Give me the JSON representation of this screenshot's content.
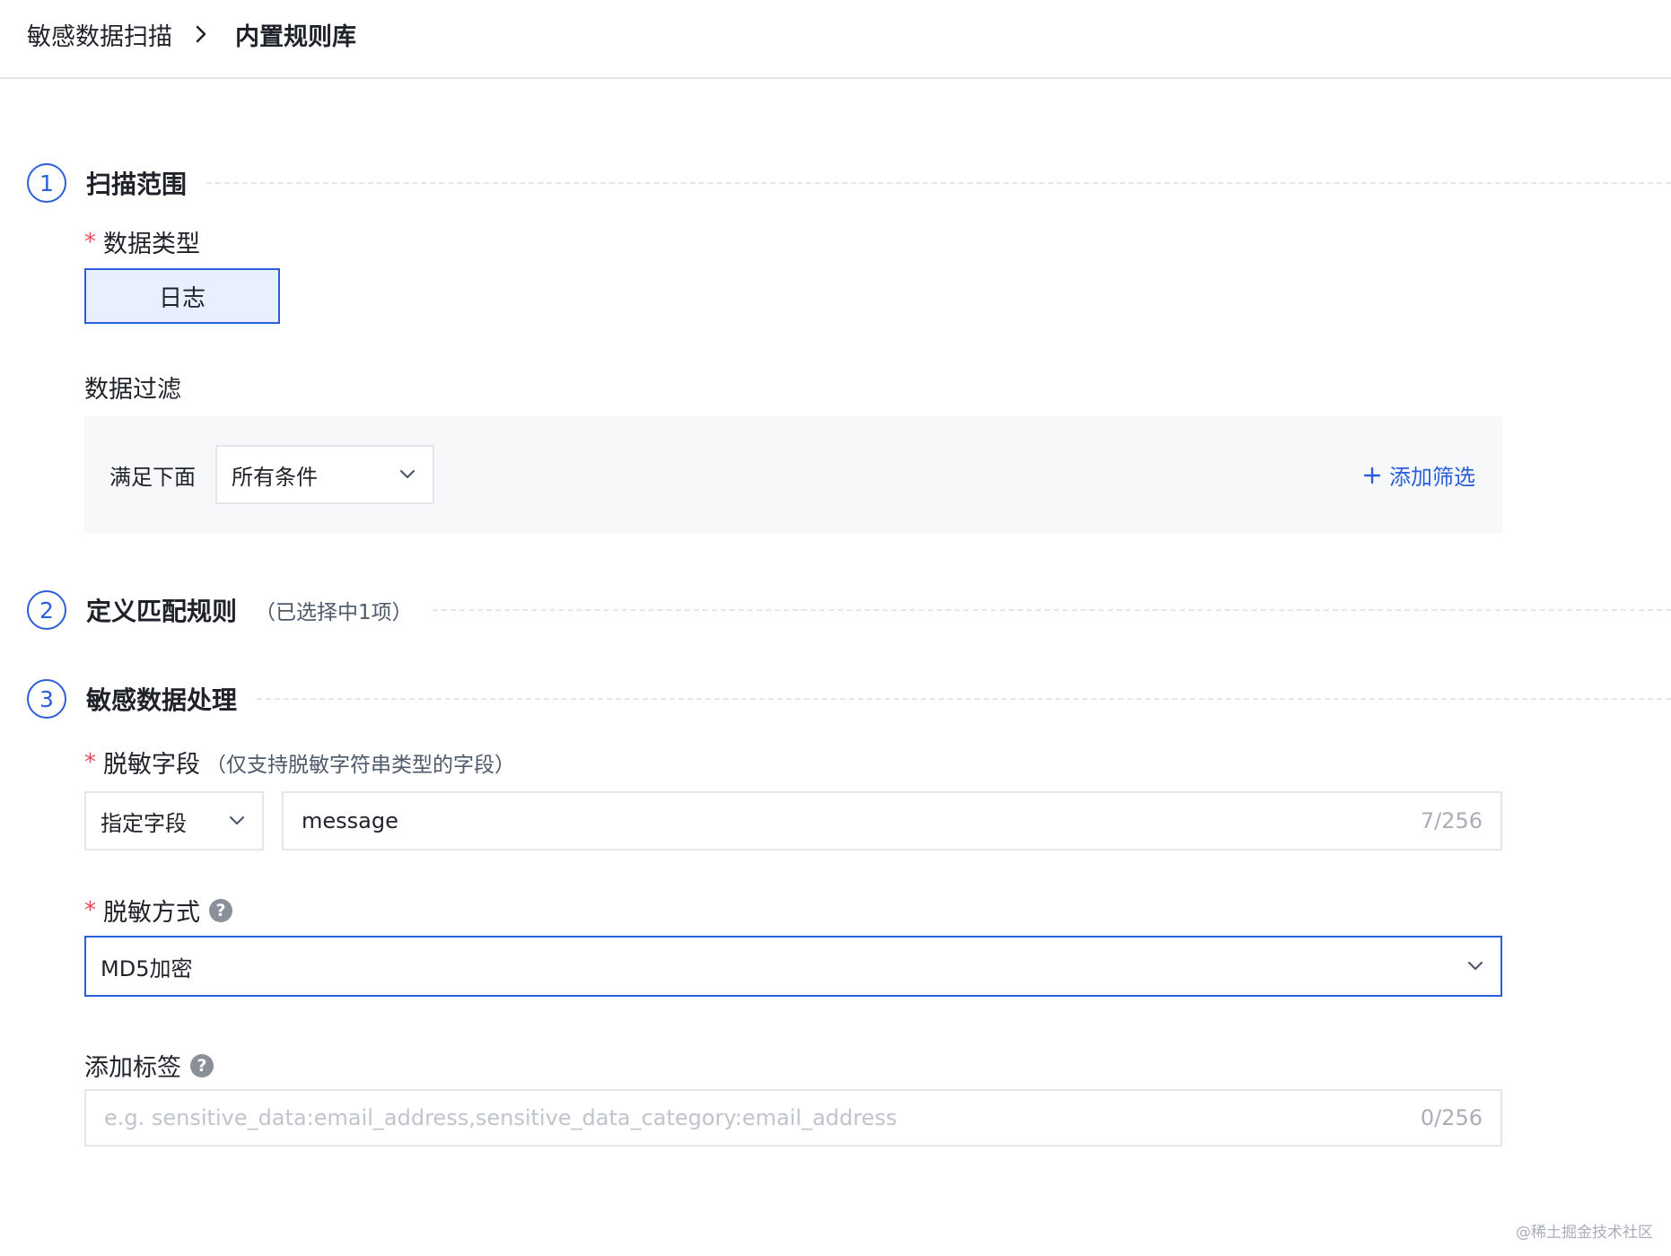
{
  "breadcrumb": {
    "items": [
      "敏感数据扫描",
      "内置规则库"
    ]
  },
  "sections": {
    "scan_scope": {
      "number": "1",
      "title": "扫描范围",
      "data_type": {
        "label": "数据类型",
        "option": "日志"
      },
      "data_filter": {
        "label": "数据过滤",
        "condition_prefix": "满足下面",
        "condition_value": "所有条件",
        "add_filter": "添加筛选"
      }
    },
    "match_rules": {
      "number": "2",
      "title": "定义匹配规则",
      "note": "（已选择中1项）"
    },
    "processing": {
      "number": "3",
      "title": "敏感数据处理",
      "mask_field": {
        "label": "脱敏字段",
        "note": "（仅支持脱敏字符串类型的字段）",
        "mode": "指定字段",
        "value": "message",
        "count": "7/256"
      },
      "mask_method": {
        "label": "脱敏方式",
        "value": "MD5加密"
      },
      "tags": {
        "label": "添加标签",
        "placeholder": "e.g. sensitive_data:email_address,sensitive_data_category:email_address",
        "count": "0/256"
      }
    }
  },
  "watermark": "@稀土掘金技术社区",
  "colors": {
    "accent": "#2b5fd9",
    "required": "#e34d59",
    "panel_bg": "#f7f8fa",
    "border": "#e5e6eb"
  }
}
